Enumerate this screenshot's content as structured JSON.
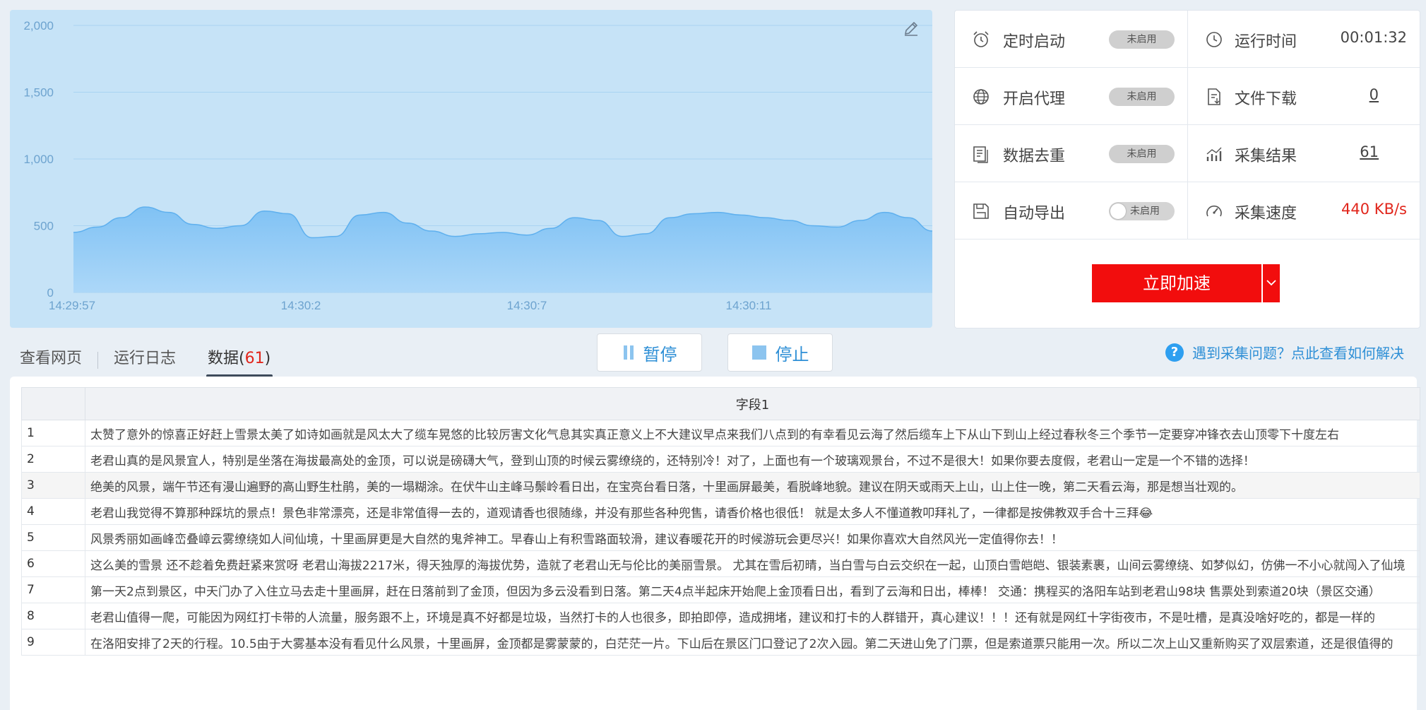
{
  "chart": {
    "y_ticks": [
      "2,000",
      "1,500",
      "1,000",
      "500",
      "0"
    ],
    "x_ticks": [
      "14:29:57",
      "14:30:2",
      "14:30:7",
      "14:30:11"
    ]
  },
  "chart_data": {
    "type": "area",
    "ylim": [
      0,
      2000
    ],
    "y_ticks": [
      0,
      500,
      1000,
      1500,
      2000
    ],
    "x_tick_labels": [
      "14:29:57",
      "14:30:2",
      "14:30:7",
      "14:30:11"
    ],
    "grid": true,
    "colors": {
      "fill": "#7dc0f5",
      "line": "#5fb0ee",
      "background": "#c6e3f7"
    },
    "values": [
      450,
      490,
      560,
      640,
      600,
      510,
      480,
      500,
      610,
      590,
      410,
      420,
      580,
      600,
      520,
      460,
      420,
      440,
      450,
      430,
      480,
      560,
      540,
      420,
      440,
      560,
      590,
      600,
      580,
      560,
      540,
      500,
      490,
      540,
      600,
      560,
      460
    ]
  },
  "status": {
    "scheduled_start": {
      "label": "定时启动",
      "value": "未启用"
    },
    "run_time": {
      "label": "运行时间",
      "value": "00:01:32"
    },
    "proxy": {
      "label": "开启代理",
      "value": "未启用"
    },
    "file_download": {
      "label": "文件下载",
      "value": "0"
    },
    "dedup": {
      "label": "数据去重",
      "value": "未启用"
    },
    "results": {
      "label": "采集结果",
      "value": "61"
    },
    "auto_export": {
      "label": "自动导出",
      "value": "未启用"
    },
    "speed": {
      "label": "采集速度",
      "value": "440 KB/s"
    },
    "accelerate": "立即加速"
  },
  "tabs": {
    "view_page": "查看网页",
    "run_log": "运行日志",
    "data_prefix": "数据(",
    "data_count": "61",
    "data_suffix": ")"
  },
  "controls": {
    "pause": "暂停",
    "stop": "停止"
  },
  "help": {
    "text": "遇到采集问题？点此查看如何解决",
    "icon": "?"
  },
  "table": {
    "header": "字段1",
    "rows": [
      {
        "idx": "1",
        "text": "太赞了意外的惊喜正好赶上雪景太美了如诗如画就是风太大了缆车晃悠的比较厉害文化气息其实真正意义上不大建议早点来我们八点到的有幸看见云海了然后缆车上下从山下到山上经过春秋冬三个季节一定要穿冲锋衣去山顶零下十度左右"
      },
      {
        "idx": "2",
        "text": "老君山真的是风景宜人，特别是坐落在海拔最高处的金顶，可以说是磅礴大气，登到山顶的时候云雾缭绕的，还特别冷！对了，上面也有一个玻璃观景台，不过不是很大！如果你要去度假，老君山一定是一个不错的选择！"
      },
      {
        "idx": "3",
        "text": "绝美的风景，端午节还有漫山遍野的高山野生杜鹃，美的一塌糊涂。在伏牛山主峰马鬃岭看日出，在宝亮台看日落，十里画屏最美，看脱峰地貌。建议在阴天或雨天上山，山上住一晚，第二天看云海，那是想当壮观的。"
      },
      {
        "idx": "4",
        "text": "老君山我觉得不算那种踩坑的景点！景色非常漂亮，还是非常值得一去的，道观请香也很随缘，并没有那些各种兜售，请香价格也很低！ 就是太多人不懂道教叩拜礼了，一律都是按佛教双手合十三拜😂"
      },
      {
        "idx": "5",
        "text": "风景秀丽如画峰峦叠嶂云雾缭绕如人间仙境，十里画屏更是大自然的鬼斧神工。早春山上有积雪路面较滑，建议春暖花开的时候游玩会更尽兴！如果你喜欢大自然风光一定值得你去！！"
      },
      {
        "idx": "6",
        "text": "这么美的雪景 还不趁着免费赶紧来赏呀 老君山海拔2217米，得天独厚的海拔优势，造就了老君山无与伦比的美丽雪景。 尤其在雪后初晴，当白雪与白云交织在一起，山顶白雪皑皑、银装素裹，山间云雾缭绕、如梦似幻，仿佛一不小心就闯入了仙境"
      },
      {
        "idx": "7",
        "text": "第一天2点到景区，中天门办了入住立马去走十里画屏，赶在日落前到了金顶，但因为多云没看到日落。第二天4点半起床开始爬上金顶看日出，看到了云海和日出，棒棒！ 交通：携程买的洛阳车站到老君山98块 售票处到索道20块（景区交通）"
      },
      {
        "idx": "8",
        "text": "老君山值得一爬，可能因为网红打卡带的人流量，服务跟不上，环境是真不好都是垃圾，当然打卡的人也很多，即拍即停，造成拥堵，建议和打卡的人群错开，真心建议！！！还有就是网红十字街夜市，不是吐槽，是真没啥好吃的，都是一样的"
      },
      {
        "idx": "9",
        "text": "在洛阳安排了2天的行程。10.5由于大雾基本没有看见什么风景，十里画屏，金顶都是雾蒙蒙的，白茫茫一片。下山后在景区门口登记了2次入园。第二天进山免了门票，但是索道票只能用一次。所以二次上山又重新购买了双层索道，还是很值得的"
      }
    ]
  }
}
